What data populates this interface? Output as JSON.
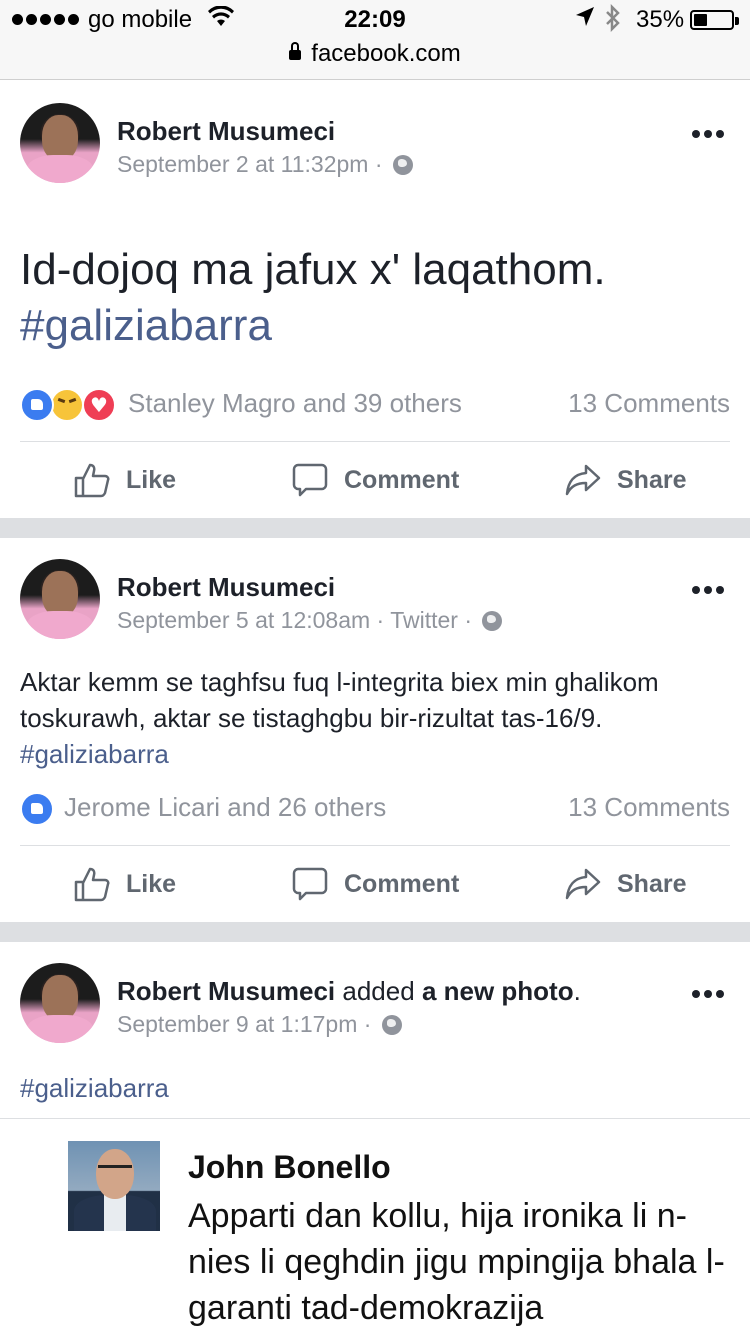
{
  "status_bar": {
    "carrier": "go mobile",
    "time": "22:09",
    "battery": "35%",
    "battery_level": 0.35
  },
  "url_bar": {
    "domain": "facebook.com"
  },
  "posts": [
    {
      "author": "Robert Musumeci",
      "date": "September 2 at 11:32pm",
      "text": "Id-dojoq ma jafux x' laqathom.",
      "hashtag": "#galiziabarra",
      "reaction_names": "Stanley Magro and 39 others",
      "reaction_types": [
        "like",
        "haha",
        "love"
      ],
      "comments": "13 Comments"
    },
    {
      "author": "Robert Musumeci",
      "date": "September 5 at 12:08am",
      "source": "Twitter",
      "text": "Aktar kemm se taghfsu fuq l-integrita biex min ghalikom toskurawh, aktar se tistaghgbu bir-rizultat tas-16/9.",
      "hashtag": "#galiziabarra",
      "reaction_names": "Jerome Licari and 26 others",
      "reaction_types": [
        "like"
      ],
      "comments": "13 Comments"
    },
    {
      "author": "Robert Musumeci",
      "action": "added",
      "action_object": "a new photo",
      "date": "September 9 at 1:17pm",
      "hashtag": "#galiziabarra",
      "photo": {
        "quoted_name": "John Bonello",
        "quoted_text": "Apparti dan kollu, hija ironika li n-nies li qeghdin jigu mpingija bhala l-garanti tad-demokrazija"
      }
    }
  ],
  "actions": {
    "like": "Like",
    "comment": "Comment",
    "share": "Share"
  },
  "icons": {
    "more": "more-options-icon",
    "privacy": "globe-icon",
    "like": "thumbs-up-icon",
    "comment": "comment-bubble-icon",
    "share": "share-arrow-icon"
  },
  "colors": {
    "hashtag": "#4b5f8c",
    "meta": "#90949c",
    "like_reaction": "#3b7cf0",
    "love_reaction": "#ef3e55",
    "haha_reaction": "#f7c43a",
    "separator": "#dddfe2"
  }
}
